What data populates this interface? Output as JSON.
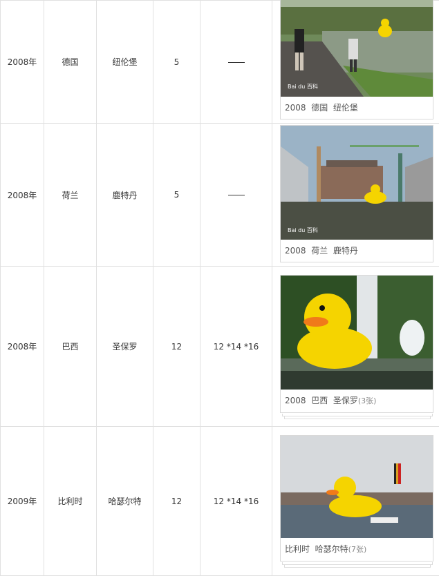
{
  "rows": [
    {
      "year": "2008年",
      "country": "德国",
      "city": "纽伦堡",
      "height": "5",
      "size": "",
      "caption_parts": [
        "2008",
        "德国",
        "纽伦堡"
      ],
      "caption_count": "",
      "watermark": "Bai du 百科"
    },
    {
      "year": "2008年",
      "country": "荷兰",
      "city": "鹿特丹",
      "height": "5",
      "size": "",
      "caption_parts": [
        "2008",
        "荷兰",
        "鹿特丹"
      ],
      "caption_count": "",
      "watermark": "Bai du 百科"
    },
    {
      "year": "2008年",
      "country": "巴西",
      "city": "圣保罗",
      "height": "12",
      "size": "12 *14 *16",
      "caption_parts": [
        "2008",
        "巴西",
        "圣保罗"
      ],
      "caption_count": "(3张)"
    },
    {
      "year": "2009年",
      "country": "比利时",
      "city": "哈瑟尔特",
      "height": "12",
      "size": "12 *14 *16",
      "caption_parts": [
        "比利时",
        "哈瑟尔特"
      ],
      "caption_count": "(7张)"
    }
  ],
  "colors": {
    "duck_yellow": "#f5d400",
    "beak_orange": "#f07a1a",
    "border": "#e0e0e0"
  }
}
